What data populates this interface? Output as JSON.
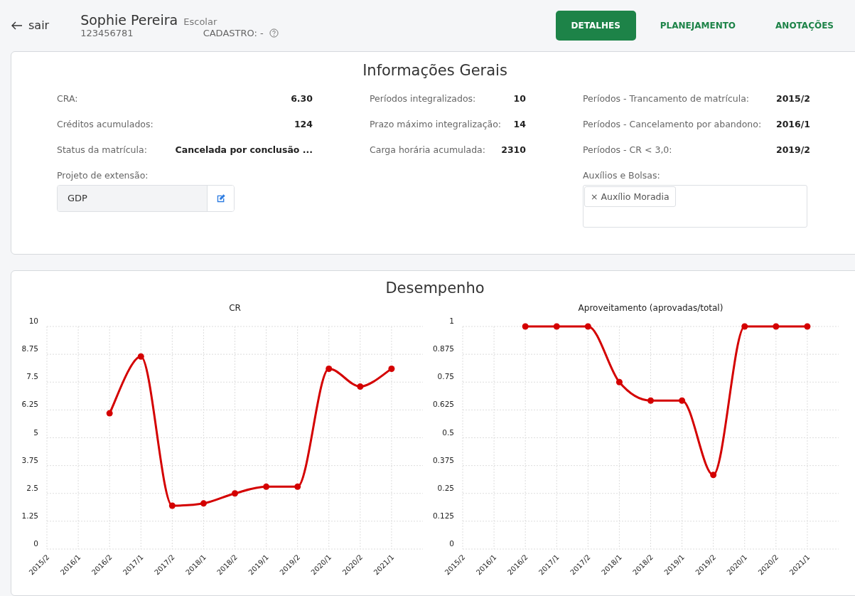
{
  "header": {
    "back_label": "sair",
    "name": "Sophie Pereira",
    "category": "Escolar",
    "id": "123456781",
    "cadastro": "CADASTRO: -"
  },
  "tabs": [
    {
      "label": "DETALHES",
      "selected": true
    },
    {
      "label": "PLANEJAMENTO",
      "selected": false
    },
    {
      "label": "ANOTAÇÕES",
      "selected": false
    }
  ],
  "general": {
    "title": "Informações Gerais",
    "columns": [
      [
        {
          "label": "CRA:",
          "value": "6.30"
        },
        {
          "label": "Créditos acumulados:",
          "value": "124"
        },
        {
          "label": "Status da matrícula:",
          "value": "Cancelada por conclusão ..."
        }
      ],
      [
        {
          "label": "Períodos integralizados:",
          "value": "10"
        },
        {
          "label": "Prazo máximo integralização:",
          "value": "14"
        },
        {
          "label": "Carga horária acumulada:",
          "value": "2310"
        }
      ],
      [
        {
          "label": "Períodos - Trancamento de matrícula:",
          "value": "2015/2"
        },
        {
          "label": "Períodos - Cancelamento por abandono:",
          "value": "2016/1"
        },
        {
          "label": "Períodos - CR < 3,0:",
          "value": "2019/2"
        }
      ]
    ],
    "extension": {
      "label": "Projeto de extensão:",
      "value": "GDP"
    },
    "aid": {
      "label": "Auxílios e Bolsas:",
      "tags": [
        {
          "remove": "×",
          "label": "Auxílio Moradia"
        }
      ]
    }
  },
  "performance": {
    "title": "Desempenho",
    "charts": [
      {
        "chart_data": {
          "type": "line",
          "title": "CR",
          "categories": [
            "2015/2",
            "2016/1",
            "2016/2",
            "2017/1",
            "2017/2",
            "2018/1",
            "2018/2",
            "2019/1",
            "2019/2",
            "2020/1",
            "2020/2",
            "2021/1"
          ],
          "grid": true,
          "series": [
            {
              "color": "#d40000",
              "marker": true,
              "values": [
                null,
                null,
                6.1,
                8.65,
                1.95,
                2.05,
                2.5,
                2.8,
                2.8,
                8.1,
                7.3,
                8.1
              ]
            }
          ],
          "ylim": [
            0,
            10
          ],
          "yticks": [
            0,
            1.25,
            2.5,
            3.75,
            5,
            6.25,
            7.5,
            8.75,
            10
          ]
        }
      },
      {
        "chart_data": {
          "type": "line",
          "title": "Aproveitamento (aprovadas/total)",
          "categories": [
            "2015/2",
            "2016/1",
            "2016/2",
            "2017/1",
            "2017/2",
            "2018/1",
            "2018/2",
            "2019/1",
            "2019/2",
            "2020/1",
            "2020/2",
            "2021/1"
          ],
          "grid": true,
          "series": [
            {
              "color": "#d40000",
              "marker": true,
              "values": [
                null,
                null,
                1,
                1,
                1,
                0.75,
                0.667,
                0.667,
                0.333,
                1,
                1,
                1
              ]
            }
          ],
          "ylim": [
            0,
            1
          ],
          "yticks": [
            0,
            0.125,
            0.25,
            0.375,
            0.5,
            0.625,
            0.75,
            0.875,
            1
          ]
        }
      }
    ]
  }
}
